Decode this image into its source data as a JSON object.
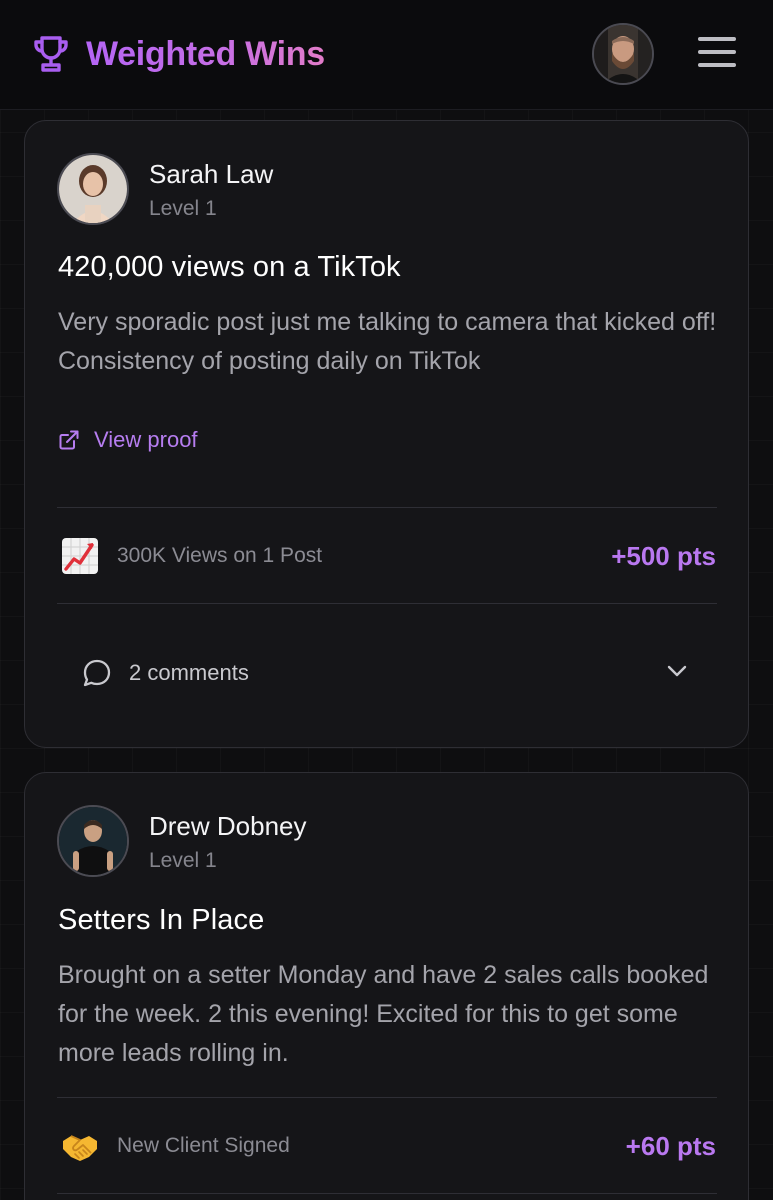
{
  "header": {
    "app_title": "Weighted Wins",
    "trophy_icon": "trophy-icon",
    "menu_icon": "hamburger-menu-icon",
    "accent_color": "#b565f5"
  },
  "posts": [
    {
      "author": "Sarah Law",
      "level": "Level 1",
      "title": "420,000 views on a TikTok",
      "body": "Very sporadic post just me talking to camera that kicked off! Consistency of posting daily on TikTok",
      "proof_label": "View proof",
      "achievement_icon": "chart-increasing-emoji",
      "achievement": "300K Views on 1 Post",
      "points": "+500 pts",
      "comments": "2 comments"
    },
    {
      "author": "Drew Dobney",
      "level": "Level 1",
      "title": "Setters In Place",
      "body": "Brought on a setter Monday and have 2 sales calls booked for the week. 2 this evening! Excited for this to get some more leads rolling in.",
      "achievement_icon": "handshake-emoji",
      "achievement": "New Client Signed",
      "points": "+60 pts"
    }
  ]
}
